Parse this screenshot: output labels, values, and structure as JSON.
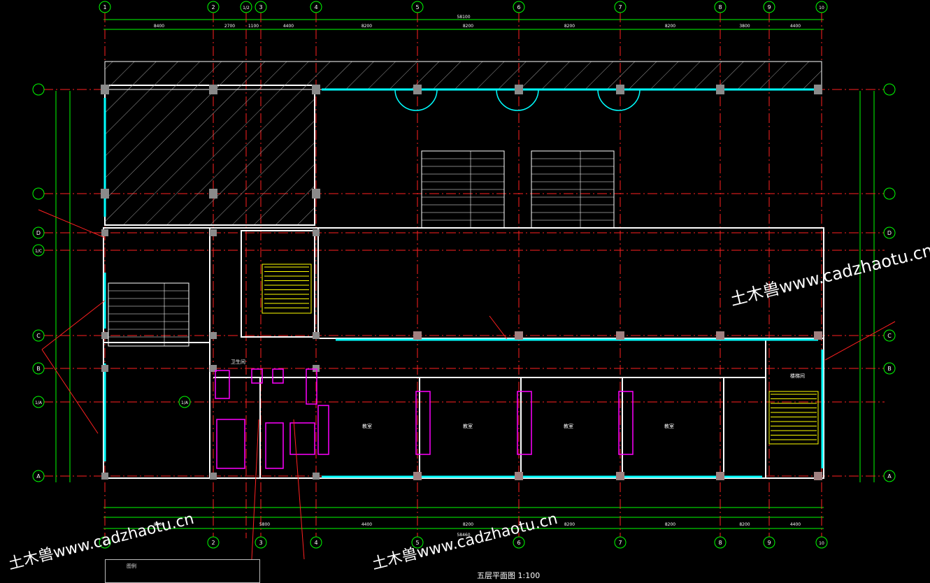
{
  "drawing": {
    "title": "五层平面图",
    "scale": "1:100",
    "legend_label": "图例"
  },
  "watermarks": {
    "primary": "土木兽www.cadzhaotu.cn",
    "secondary_left": "土木兽www.cadzhaotu.cn",
    "secondary_mid": "土木兽www.cadzhaotu.cn"
  },
  "grid_columns": [
    "1",
    "2",
    "1/2",
    "3",
    "4",
    "5",
    "6",
    "7",
    "8",
    "9",
    "10"
  ],
  "grid_rows": [
    "D",
    "1/C",
    "C",
    "B",
    "1/A",
    "A"
  ],
  "dimensions": {
    "total_top": "58100",
    "total_bottom": "58460",
    "top_spans": [
      "8400",
      "2700",
      "1100",
      "4400",
      "8200",
      "8200",
      "8200",
      "8200",
      "3800",
      "4400"
    ],
    "bottom_spans": [
      "8400",
      "5800",
      "4400",
      "8200",
      "8200",
      "8200",
      "8200",
      "4400"
    ]
  },
  "room_labels": [
    "教室",
    "教室",
    "教室",
    "教室",
    "楼梯间",
    "卫生间"
  ],
  "colors": {
    "grid": "#00ff00",
    "axis": "#ff2020",
    "wall": "#ffffff",
    "window": "#00ffff",
    "fixture": "#ff00ff",
    "stair": "#ffff00",
    "column": "#888888"
  }
}
